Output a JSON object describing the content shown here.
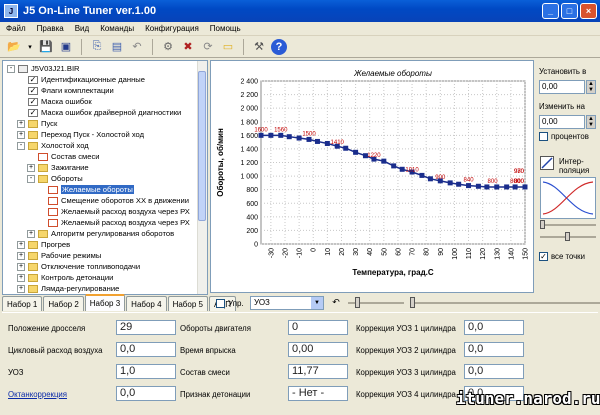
{
  "window": {
    "title": "J5 On-Line Tuner ver.1.00"
  },
  "menu": [
    "Файл",
    "Правка",
    "Вид",
    "Команды",
    "Конфигурация",
    "Помощь"
  ],
  "tree": {
    "root": "J5V03J21.BIR",
    "items": [
      {
        "label": "Идентификационные данные",
        "indent": 1,
        "icon": "check",
        "exp": ""
      },
      {
        "label": "Флаги комплектации",
        "indent": 1,
        "icon": "check",
        "exp": ""
      },
      {
        "label": "Маска ошибок",
        "indent": 1,
        "icon": "check",
        "exp": ""
      },
      {
        "label": "Маска ошибок драйверной диагностики",
        "indent": 1,
        "icon": "check",
        "exp": ""
      },
      {
        "label": "Пуск",
        "indent": 1,
        "icon": "folder",
        "exp": "+"
      },
      {
        "label": "Переход Пуск - Холостой ход",
        "indent": 1,
        "icon": "folder",
        "exp": "+"
      },
      {
        "label": "Холостой ход",
        "indent": 1,
        "icon": "folder",
        "exp": "-"
      },
      {
        "label": "Состав смеси",
        "indent": 2,
        "icon": "doc",
        "exp": ""
      },
      {
        "label": "Зажигание",
        "indent": 2,
        "icon": "folder",
        "exp": "+"
      },
      {
        "label": "Обороты",
        "indent": 2,
        "icon": "folder",
        "exp": "-"
      },
      {
        "label": "Желаемые обороты",
        "indent": 3,
        "icon": "doc",
        "exp": "",
        "selected": true
      },
      {
        "label": "Смещение оборотов ХХ в движении",
        "indent": 3,
        "icon": "doc",
        "exp": ""
      },
      {
        "label": "Желаемый расход воздуха через РХ",
        "indent": 3,
        "icon": "doc",
        "exp": ""
      },
      {
        "label": "Желаемый расход воздуха через РХ",
        "indent": 3,
        "icon": "doc",
        "exp": ""
      },
      {
        "label": "Алгоритм регулирования оборотов",
        "indent": 2,
        "icon": "folder",
        "exp": "+"
      },
      {
        "label": "Прогрев",
        "indent": 1,
        "icon": "folder",
        "exp": "+"
      },
      {
        "label": "Рабочие режимы",
        "indent": 1,
        "icon": "folder",
        "exp": "+"
      },
      {
        "label": "Отключение топливоподачи",
        "indent": 1,
        "icon": "folder",
        "exp": "+"
      },
      {
        "label": "Контроль детонации",
        "indent": 1,
        "icon": "folder",
        "exp": "+"
      },
      {
        "label": "Лямда-регулирование",
        "indent": 1,
        "icon": "folder",
        "exp": "+"
      }
    ]
  },
  "chart_data": {
    "type": "line",
    "title": "Желаемые обороты",
    "xlabel": "Температура, град.С",
    "ylabel": "Обороты, об/мин",
    "x": [
      -30,
      -20,
      -10,
      0,
      10,
      20,
      30,
      40,
      50,
      60,
      70,
      80,
      90,
      100,
      110,
      120,
      130,
      140,
      150
    ],
    "xticks": [
      "-30",
      "-20",
      "-10",
      "0",
      "10",
      "20",
      "30",
      "40",
      "50",
      "60",
      "70",
      "80",
      "90",
      "100",
      "110",
      "120",
      "130",
      "140",
      "150"
    ],
    "yticks": [
      "0",
      "200",
      "400",
      "600",
      "800",
      "1 000",
      "1 200",
      "1 400",
      "1 600",
      "1 800",
      "2 000",
      "2 200",
      "2 400"
    ],
    "ylim": [
      0,
      2400
    ],
    "xlim": [
      -37,
      150
    ],
    "series": [
      {
        "values": [
          1600,
          1600,
          1580,
          1540,
          1480,
          1410,
          1320,
          1220,
          1110,
          1010,
          940,
          900,
          870,
          850,
          840,
          840,
          860,
          920,
          970,
          990,
          1000,
          1000,
          1000,
          1000,
          1000
        ]
      }
    ],
    "point_x": [
      -37,
      -30,
      -23,
      -17,
      -10,
      -3,
      3,
      10,
      17,
      23,
      30,
      37,
      43,
      50,
      57,
      63,
      70,
      77,
      83,
      90,
      97,
      103,
      110,
      117,
      123,
      130,
      137,
      143,
      150
    ],
    "point_y": [
      1600,
      1600,
      1600,
      1580,
      1560,
      1540,
      1510,
      1480,
      1440,
      1410,
      1350,
      1300,
      1250,
      1220,
      1150,
      1100,
      1060,
      1010,
      960,
      930,
      900,
      880,
      860,
      850,
      840,
      840,
      840,
      840,
      840
    ],
    "labels": [
      {
        "text": "1600",
        "x": -37,
        "y": 1600
      },
      {
        "text": "1560",
        "x": -23,
        "y": 1600
      },
      {
        "text": "1500",
        "x": -3,
        "y": 1540
      },
      {
        "text": "1410",
        "x": 17,
        "y": 1410
      },
      {
        "text": "1220",
        "x": 43,
        "y": 1220
      },
      {
        "text": "1010",
        "x": 70,
        "y": 1010
      },
      {
        "text": "900",
        "x": 90,
        "y": 900
      },
      {
        "text": "840",
        "x": 110,
        "y": 860
      },
      {
        "text": "800",
        "x": 127,
        "y": 840
      },
      {
        "text": "800",
        "x": 143,
        "y": 840
      },
      {
        "text": "800",
        "x": 158,
        "y": 840
      },
      {
        "text": "800",
        "x": 178,
        "y": 840
      },
      {
        "text": "970",
        "x": 197,
        "y": 990
      },
      {
        "text": "980",
        "x": 215,
        "y": 990
      }
    ],
    "grid": true,
    "color": "#1a2d8c"
  },
  "right": {
    "set_label": "Установить в",
    "set_value": "0,00",
    "change_label": "Изменить на",
    "change_value": "0,00",
    "percent_label": "процентов",
    "interp_label": "Интер-поляция",
    "all_points_label": "все точки"
  },
  "tabs": [
    "Набор 1",
    "Набор 2",
    "Набор 3",
    "Набор 4",
    "Набор 5",
    "АЦП"
  ],
  "active_tab": 2,
  "controls": {
    "manage_label": "Упр.",
    "combo_value": "УОЗ"
  },
  "data": {
    "col1": [
      {
        "label": "Положение дросселя",
        "value": "29"
      },
      {
        "label": "Цикловый расход воздуха",
        "value": "0,0"
      },
      {
        "label": "УОЗ",
        "value": "1,0"
      },
      {
        "label": "Октанкоррекция",
        "value": "0,0",
        "link": true
      }
    ],
    "col2": [
      {
        "label": "Обороты двигателя",
        "value": "0"
      },
      {
        "label": "Время впрыска",
        "value": "0,00"
      },
      {
        "label": "Состав смеси",
        "value": "11,77"
      },
      {
        "label": "Признак детонации",
        "value": "- Нет -"
      }
    ],
    "col3": [
      {
        "label": "Коррекция УОЗ 1 цилиндра",
        "value": "0,0"
      },
      {
        "label": "Коррекция УОЗ 2 цилиндра",
        "value": "0,0"
      },
      {
        "label": "Коррекция УОЗ 3 цилиндра",
        "value": "0,0"
      },
      {
        "label": "Коррекция УОЗ 4 цилиндра",
        "value": "0,0"
      }
    ]
  },
  "watermark": "ituner.narod.ru"
}
